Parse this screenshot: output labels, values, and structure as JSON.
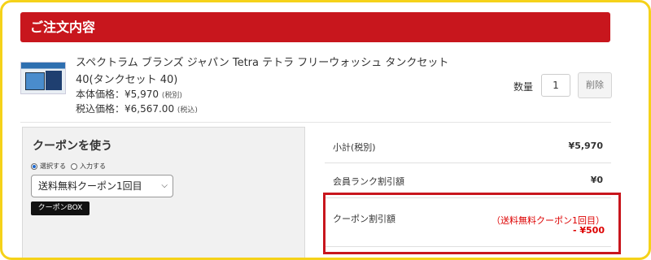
{
  "section": {
    "title": "ご注文内容"
  },
  "product": {
    "name": "スペクトラム ブランズ ジャパン Tetra テトラ フリーウォッシュ タンクセット 40(タンクセット 40)",
    "base_price_label": "本体価格：¥5,970",
    "base_price_note": "(税別)",
    "tax_price_label": "税込価格：¥6,567.00",
    "tax_price_note": "(税込)",
    "quantity_label": "数量",
    "quantity_value": "1",
    "delete_label": "削除"
  },
  "coupon": {
    "title": "クーポンを使う",
    "radio_select_label": "選択する",
    "radio_input_label": "入力する",
    "selected_option": "送料無料クーポン1回目",
    "box_button_label": "クーポンBOX"
  },
  "summary": {
    "subtotal_label": "小計(税別)",
    "subtotal_value": "¥5,970",
    "rank_discount_label": "会員ランク割引額",
    "rank_discount_value": "¥0",
    "coupon_discount_label": "クーポン割引額",
    "coupon_discount_name": "（送料無料クーポン1回目）",
    "coupon_discount_value": "- ¥500"
  },
  "colors": {
    "header_red": "#c8161d",
    "frame_yellow": "#f5d21a",
    "discount_red": "#dd0000"
  }
}
